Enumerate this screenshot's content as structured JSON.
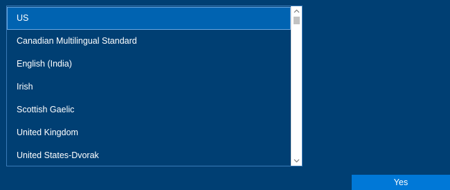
{
  "keyboard_list": {
    "items": [
      {
        "label": "US",
        "selected": true
      },
      {
        "label": "Canadian Multilingual Standard",
        "selected": false
      },
      {
        "label": "English (India)",
        "selected": false
      },
      {
        "label": "Irish",
        "selected": false
      },
      {
        "label": "Scottish Gaelic",
        "selected": false
      },
      {
        "label": "United Kingdom",
        "selected": false
      },
      {
        "label": "United States-Dvorak",
        "selected": false
      }
    ]
  },
  "scrollbar": {
    "up_icon": "chevron-up-icon",
    "down_icon": "chevron-down-icon",
    "position": 0
  },
  "footer": {
    "yes_label": "Yes"
  },
  "colors": {
    "background": "#003f73",
    "selected_item": "#0063b1",
    "button": "#0078d7",
    "text": "#ffffff"
  }
}
